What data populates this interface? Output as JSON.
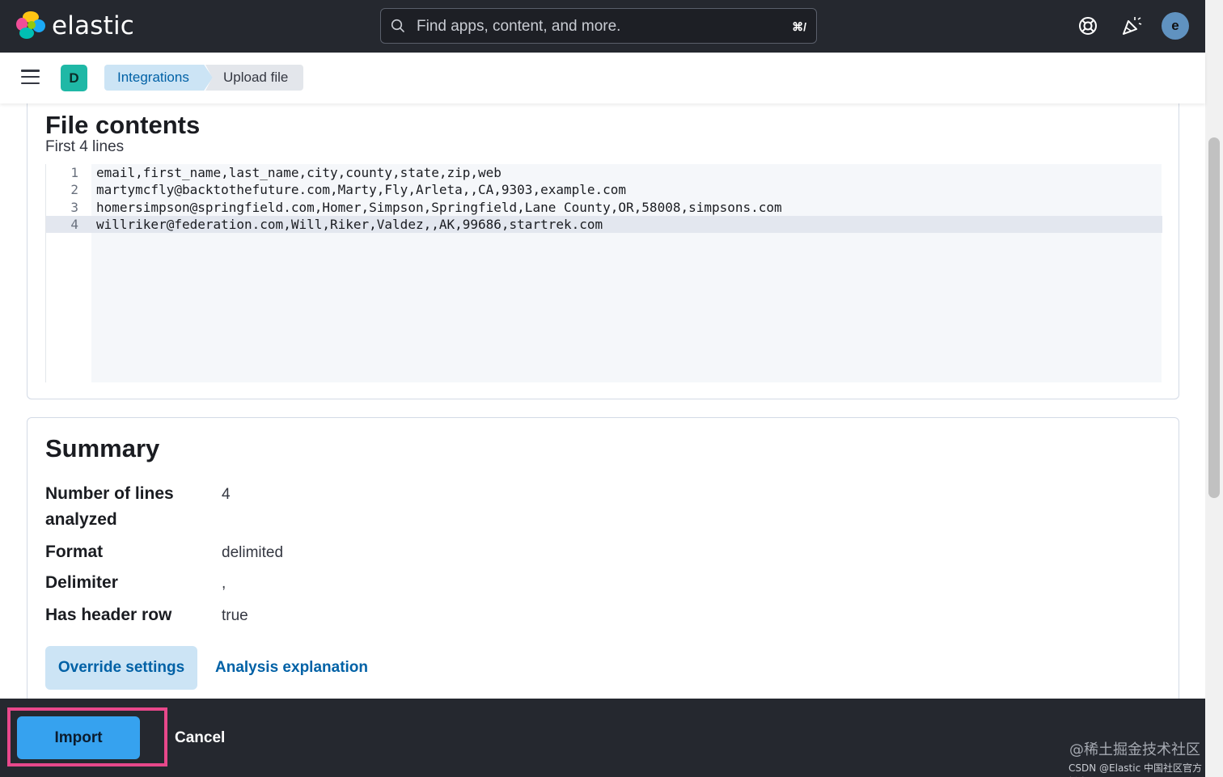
{
  "header": {
    "brand": "elastic",
    "search_placeholder": "Find apps, content, and more.",
    "search_shortcut": "⌘/",
    "avatar_initial": "e",
    "icons": [
      "help-icon",
      "news-feed-icon"
    ]
  },
  "subheader": {
    "space_initial": "D",
    "breadcrumbs": [
      "Integrations",
      "Upload file"
    ]
  },
  "file_contents": {
    "title": "File contents",
    "subtitle": "First 4 lines",
    "lines": [
      {
        "number": "1",
        "text": "email,first_name,last_name,city,county,state,zip,web"
      },
      {
        "number": "2",
        "text": "martymcfly@backtothefuture.com,Marty,Fly,Arleta,,CA,9303,example.com"
      },
      {
        "number": "3",
        "text": "homersimpson@springfield.com,Homer,Simpson,Springfield,Lane County,OR,58008,simpsons.com"
      },
      {
        "number": "4",
        "text": "willriker@federation.com,Will,Riker,Valdez,,AK,99686,startrek.com"
      }
    ]
  },
  "summary": {
    "title": "Summary",
    "rows": [
      {
        "label": "Number of lines analyzed",
        "value": "4"
      },
      {
        "label": "Format",
        "value": "delimited"
      },
      {
        "label": "Delimiter",
        "value": ","
      },
      {
        "label": "Has header row",
        "value": "true"
      }
    ],
    "override_button": "Override settings",
    "analysis_link": "Analysis explanation"
  },
  "footer": {
    "import_button": "Import",
    "cancel_button": "Cancel",
    "watermark_line1": "@稀土掘金技术社区",
    "watermark_line2": "CSDN @Elastic 中国社区官方博客"
  },
  "colors": {
    "header_bg": "#25282f",
    "primary": "#36a2ef",
    "link": "#0061a6",
    "highlight": "#e8488b"
  }
}
